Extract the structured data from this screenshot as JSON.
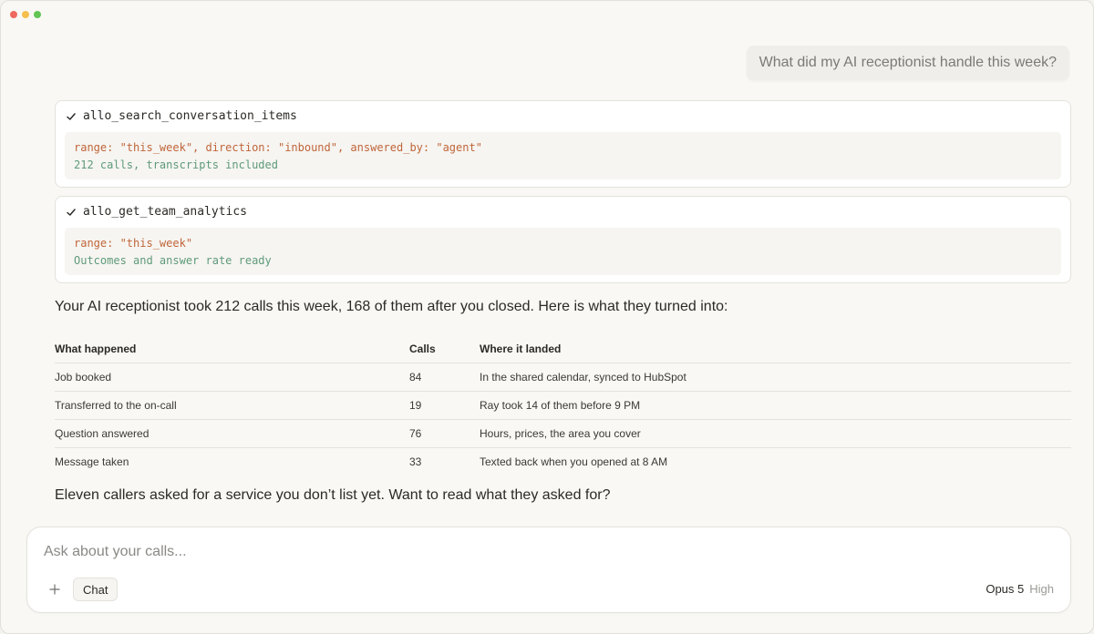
{
  "user_message": "What did my AI receptionist handle this week?",
  "tool_calls": [
    {
      "name": "allo_search_conversation_items",
      "args": "range: \"this_week\", direction: \"inbound\", answered_by: \"agent\"",
      "result": "212 calls, transcripts included"
    },
    {
      "name": "allo_get_team_analytics",
      "args": "range: \"this_week\"",
      "result": "Outcomes and answer rate ready"
    }
  ],
  "reply_intro": "Your AI receptionist took 212 calls this week, 168 of them after you closed. Here is what they turned into:",
  "table": {
    "headers": [
      "What happened",
      "Calls",
      "Where it landed"
    ],
    "rows": [
      [
        "Job booked",
        "84",
        "In the shared calendar, synced to HubSpot"
      ],
      [
        "Transferred to the on-call",
        "19",
        "Ray took 14 of them before 9 PM"
      ],
      [
        "Question answered",
        "76",
        "Hours, prices, the area you cover"
      ],
      [
        "Message taken",
        "33",
        "Texted back when you opened at 8 AM"
      ]
    ]
  },
  "reply_followup": "Eleven callers asked for a service you don’t list yet. Want to read what they asked for?",
  "composer": {
    "placeholder": "Ask about your calls...",
    "plus_icon": "plus-icon",
    "mode_label": "Chat",
    "model_name": "Opus 5",
    "effort_label": "High"
  },
  "colors": {
    "accent_green": "#5f9a7a",
    "args_orange": "#c0653a"
  }
}
